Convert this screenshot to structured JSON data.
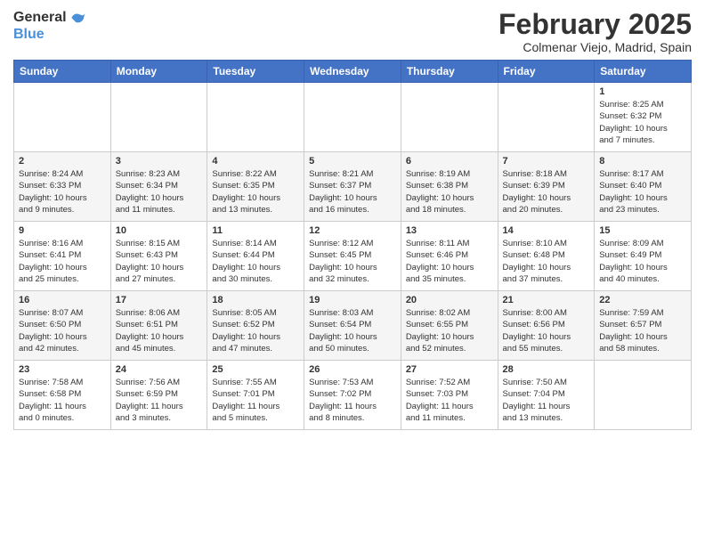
{
  "header": {
    "logo_general": "General",
    "logo_blue": "Blue",
    "month_title": "February 2025",
    "location": "Colmenar Viejo, Madrid, Spain"
  },
  "calendar": {
    "days_of_week": [
      "Sunday",
      "Monday",
      "Tuesday",
      "Wednesday",
      "Thursday",
      "Friday",
      "Saturday"
    ],
    "weeks": [
      [
        {
          "day": "",
          "info": ""
        },
        {
          "day": "",
          "info": ""
        },
        {
          "day": "",
          "info": ""
        },
        {
          "day": "",
          "info": ""
        },
        {
          "day": "",
          "info": ""
        },
        {
          "day": "",
          "info": ""
        },
        {
          "day": "1",
          "info": "Sunrise: 8:25 AM\nSunset: 6:32 PM\nDaylight: 10 hours\nand 7 minutes."
        }
      ],
      [
        {
          "day": "2",
          "info": "Sunrise: 8:24 AM\nSunset: 6:33 PM\nDaylight: 10 hours\nand 9 minutes."
        },
        {
          "day": "3",
          "info": "Sunrise: 8:23 AM\nSunset: 6:34 PM\nDaylight: 10 hours\nand 11 minutes."
        },
        {
          "day": "4",
          "info": "Sunrise: 8:22 AM\nSunset: 6:35 PM\nDaylight: 10 hours\nand 13 minutes."
        },
        {
          "day": "5",
          "info": "Sunrise: 8:21 AM\nSunset: 6:37 PM\nDaylight: 10 hours\nand 16 minutes."
        },
        {
          "day": "6",
          "info": "Sunrise: 8:19 AM\nSunset: 6:38 PM\nDaylight: 10 hours\nand 18 minutes."
        },
        {
          "day": "7",
          "info": "Sunrise: 8:18 AM\nSunset: 6:39 PM\nDaylight: 10 hours\nand 20 minutes."
        },
        {
          "day": "8",
          "info": "Sunrise: 8:17 AM\nSunset: 6:40 PM\nDaylight: 10 hours\nand 23 minutes."
        }
      ],
      [
        {
          "day": "9",
          "info": "Sunrise: 8:16 AM\nSunset: 6:41 PM\nDaylight: 10 hours\nand 25 minutes."
        },
        {
          "day": "10",
          "info": "Sunrise: 8:15 AM\nSunset: 6:43 PM\nDaylight: 10 hours\nand 27 minutes."
        },
        {
          "day": "11",
          "info": "Sunrise: 8:14 AM\nSunset: 6:44 PM\nDaylight: 10 hours\nand 30 minutes."
        },
        {
          "day": "12",
          "info": "Sunrise: 8:12 AM\nSunset: 6:45 PM\nDaylight: 10 hours\nand 32 minutes."
        },
        {
          "day": "13",
          "info": "Sunrise: 8:11 AM\nSunset: 6:46 PM\nDaylight: 10 hours\nand 35 minutes."
        },
        {
          "day": "14",
          "info": "Sunrise: 8:10 AM\nSunset: 6:48 PM\nDaylight: 10 hours\nand 37 minutes."
        },
        {
          "day": "15",
          "info": "Sunrise: 8:09 AM\nSunset: 6:49 PM\nDaylight: 10 hours\nand 40 minutes."
        }
      ],
      [
        {
          "day": "16",
          "info": "Sunrise: 8:07 AM\nSunset: 6:50 PM\nDaylight: 10 hours\nand 42 minutes."
        },
        {
          "day": "17",
          "info": "Sunrise: 8:06 AM\nSunset: 6:51 PM\nDaylight: 10 hours\nand 45 minutes."
        },
        {
          "day": "18",
          "info": "Sunrise: 8:05 AM\nSunset: 6:52 PM\nDaylight: 10 hours\nand 47 minutes."
        },
        {
          "day": "19",
          "info": "Sunrise: 8:03 AM\nSunset: 6:54 PM\nDaylight: 10 hours\nand 50 minutes."
        },
        {
          "day": "20",
          "info": "Sunrise: 8:02 AM\nSunset: 6:55 PM\nDaylight: 10 hours\nand 52 minutes."
        },
        {
          "day": "21",
          "info": "Sunrise: 8:00 AM\nSunset: 6:56 PM\nDaylight: 10 hours\nand 55 minutes."
        },
        {
          "day": "22",
          "info": "Sunrise: 7:59 AM\nSunset: 6:57 PM\nDaylight: 10 hours\nand 58 minutes."
        }
      ],
      [
        {
          "day": "23",
          "info": "Sunrise: 7:58 AM\nSunset: 6:58 PM\nDaylight: 11 hours\nand 0 minutes."
        },
        {
          "day": "24",
          "info": "Sunrise: 7:56 AM\nSunset: 6:59 PM\nDaylight: 11 hours\nand 3 minutes."
        },
        {
          "day": "25",
          "info": "Sunrise: 7:55 AM\nSunset: 7:01 PM\nDaylight: 11 hours\nand 5 minutes."
        },
        {
          "day": "26",
          "info": "Sunrise: 7:53 AM\nSunset: 7:02 PM\nDaylight: 11 hours\nand 8 minutes."
        },
        {
          "day": "27",
          "info": "Sunrise: 7:52 AM\nSunset: 7:03 PM\nDaylight: 11 hours\nand 11 minutes."
        },
        {
          "day": "28",
          "info": "Sunrise: 7:50 AM\nSunset: 7:04 PM\nDaylight: 11 hours\nand 13 minutes."
        },
        {
          "day": "",
          "info": ""
        }
      ]
    ]
  }
}
